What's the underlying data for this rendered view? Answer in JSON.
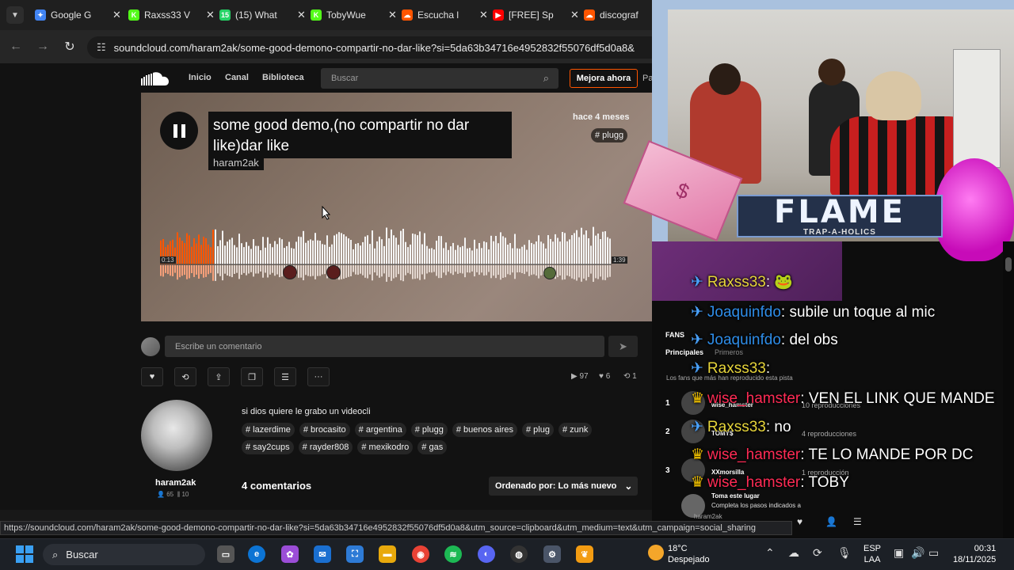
{
  "tabs": [
    {
      "title": "Google G",
      "color": "#4285f4",
      "glyph": "✦"
    },
    {
      "title": "Raxss33 V",
      "color": "#53fc18",
      "glyph": "K"
    },
    {
      "title": "(15) What",
      "color": "#25d366",
      "glyph": "15"
    },
    {
      "title": "TobyWue",
      "color": "#53fc18",
      "glyph": "K"
    },
    {
      "title": "Escucha l",
      "color": "#ff5500",
      "glyph": "☁"
    },
    {
      "title": "[FREE] Sp",
      "color": "#ff0000",
      "glyph": "▶"
    },
    {
      "title": "discograf",
      "color": "#ff5500",
      "glyph": "☁"
    }
  ],
  "address": {
    "url": "soundcloud.com/haram2ak/some-good-demono-compartir-no-dar-like?si=5da63b34716e4952832f55076df5d0a8&"
  },
  "sc": {
    "nav": {
      "home": "Inicio",
      "feed": "Canal",
      "library": "Biblioteca"
    },
    "search_placeholder": "Buscar",
    "upgrade": "Mejora ahora",
    "more": "Pa",
    "track": {
      "title": "some good demo,(no compartir no dar like)dar like",
      "artist": "haram2ak",
      "ago": "hace 4 meses",
      "tag": "# plugg",
      "time_current": "0:13",
      "time_total": "1:39",
      "progress": 0.12
    },
    "comment_placeholder": "Escribe un comentario",
    "stats": {
      "plays": "97",
      "likes": "6",
      "reposts": "1"
    },
    "artist_name": "haram2ak",
    "artist_followers": "65",
    "artist_tracks": "10",
    "description": "si dios quiere le grabo un videocli",
    "tags_row1": [
      "# lazerdime",
      "# brocasito",
      "# argentina",
      "# plugg",
      "# buenos aires",
      "# plug",
      "# zunk"
    ],
    "tags_row2": [
      "# say2cups",
      "# rayder808",
      "# mexikodro",
      "# gas"
    ],
    "comment_count": "4 comentarios",
    "sort_label": "Ordenado por: Lo más nuevo"
  },
  "status_url": "https://soundcloud.com/haram2ak/some-good-demono-compartir-no-dar-like?si=5da63b34716e4952832f55076df5d0a8&utm_source=clipboard&utm_medium=text&utm_campaign=social_sharing",
  "overlay": {
    "banner": "FLAME",
    "banner_sub": "TRAP-A-HOLICS",
    "fans": {
      "title": "FANS",
      "tab1": "Principales",
      "tab2": "Primeros",
      "subtitle": "Los fans que más han reproducido esta pista",
      "list": [
        {
          "rank": "1",
          "name": "wise_hamster",
          "plays": "10 reproducciones"
        },
        {
          "rank": "2",
          "name": "TOMY$",
          "plays": "4 reproducciones"
        },
        {
          "rank": "3",
          "name": "XXmorsilla",
          "plays": "1 reproducción"
        }
      ],
      "cta_title": "Toma este lugar",
      "cta_text": "Completa los pasos indicados a"
    },
    "chat": [
      {
        "user": "Raxss33",
        "msg": ": 🐸",
        "style": "u1"
      },
      {
        "user": "Joaquinfdo",
        "msg": ": subile un toque al mic",
        "style": "u2"
      },
      {
        "user": "Joaquinfdo",
        "msg": ": del obs",
        "style": "u2"
      },
      {
        "user": "Raxss33",
        "msg": ":",
        "style": "u1"
      },
      {
        "user": "wise_hamster",
        "msg": ": VEN EL LINK QUE MANDE",
        "style": "u3"
      },
      {
        "user": "Raxss33",
        "msg": ": no",
        "style": "u1"
      },
      {
        "user": "wise_hamster",
        "msg": ": TE LO MANDE POR DC",
        "style": "u3"
      },
      {
        "user": "wise_hamster",
        "msg": ": TOBY",
        "style": "u3"
      }
    ],
    "player_artist": "haram2ak"
  },
  "taskbar": {
    "search": "Buscar",
    "temp": "18°C",
    "weather": "Despejado",
    "lang1": "ESP",
    "lang2": "LAA",
    "time": "00:31",
    "date": "18/11/2025"
  }
}
